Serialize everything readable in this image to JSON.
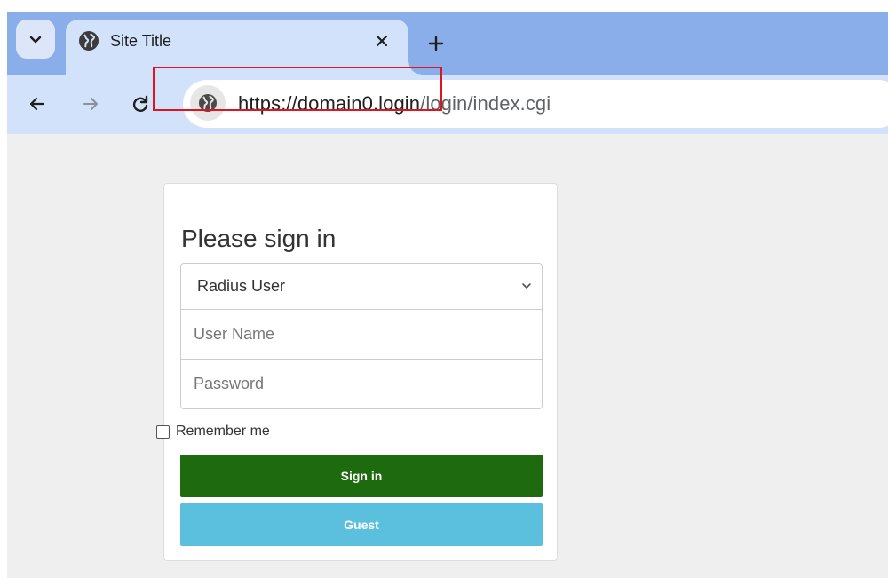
{
  "browser": {
    "tab": {
      "title": "Site Title",
      "favicon": "globe-icon"
    },
    "icons": {
      "tab_list": "chevron-down-icon",
      "tab_close": "close-icon",
      "new_tab": "plus-icon",
      "back": "arrow-left-icon",
      "forward": "arrow-right-icon",
      "reload": "reload-icon",
      "site_info": "globe-icon"
    },
    "address_bar": {
      "url_host": "https://domain0.login",
      "url_path": "/login/index.cgi"
    },
    "colors": {
      "tabstrip": "#8aaeea",
      "toolbar": "#d3e2fb",
      "highlight": "#e0141e"
    }
  },
  "login": {
    "heading": "Please sign in",
    "user_type": {
      "selected": "Radius User"
    },
    "username": {
      "placeholder": "User Name",
      "value": ""
    },
    "password": {
      "placeholder": "Password",
      "value": ""
    },
    "remember_label": "Remember me",
    "signin_label": "Sign in",
    "guest_label": "Guest",
    "colors": {
      "signin": "#1e6a0e",
      "guest": "#5bc0de"
    }
  }
}
